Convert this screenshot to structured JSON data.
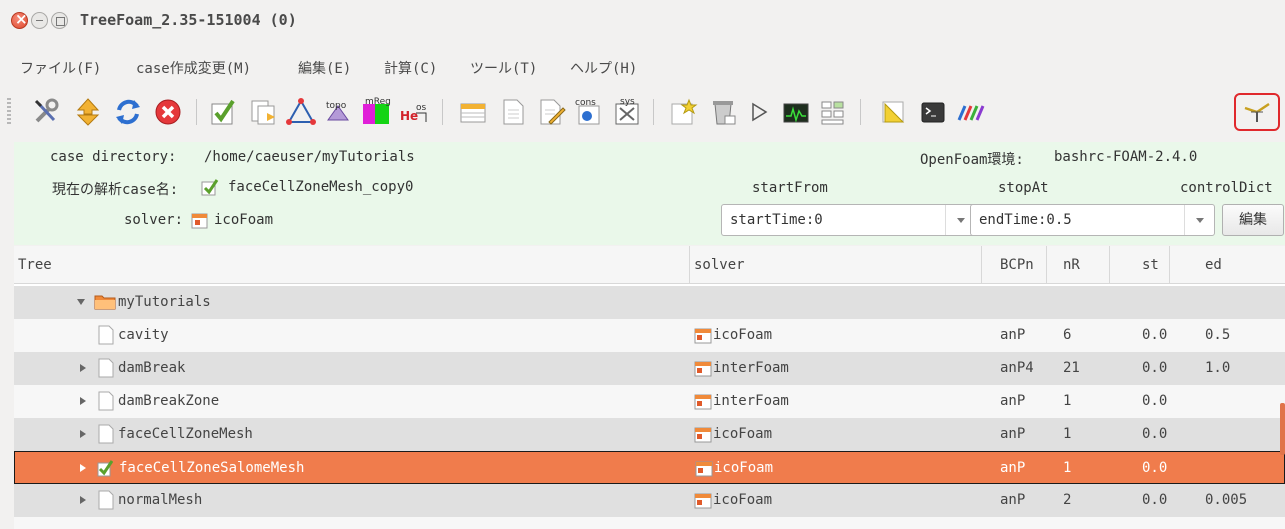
{
  "window": {
    "title": "TreeFoam_2.35-151004 (0)"
  },
  "menu": [
    "ファイル(F)",
    "case作成変更(M)",
    "編集(E)",
    "計算(C)",
    "ツール(T)",
    "ヘルプ(H)"
  ],
  "toolbar": {
    "icons": [
      "tools-icon",
      "updown-icon",
      "refresh-icon",
      "stop-icon",
      "checkmark-case-icon",
      "copy-case-icon",
      "mesh-triangle-icon",
      "topoSet-icon",
      "mReg-icon",
      "helyx-os-icon",
      "table-icon",
      "document-icon",
      "edit-document-icon",
      "constant-icon",
      "system-icon",
      "new-case-icon",
      "clear-icon",
      "run-icon",
      "monitor-icon",
      "layout-icon",
      "ruler-icon",
      "terminal-icon",
      "paraview-icon",
      "plot-icon"
    ],
    "overlay_text": {
      "topo": "topo",
      "mreg": "mReg",
      "helyx_h": "He",
      "helyx_os": "os",
      "cons": "cons",
      "sys": "sys"
    }
  },
  "info": {
    "case_dir_label": "case directory:",
    "case_dir_value": "/home/caeuser/myTutorials",
    "openfoam_label": "OpenFoam環境:",
    "openfoam_value": "bashrc-FOAM-2.4.0",
    "current_case_label": "現在の解析case名:",
    "current_case_value": "faceCellZoneMesh_copy0",
    "solver_label": "solver:",
    "solver_value": "icoFoam",
    "start_from_label": "startFrom",
    "stop_at_label": "stopAt",
    "control_dict_label": "controlDict",
    "start_from_value": "startTime:0",
    "stop_at_value": "endTime:0.5",
    "edit_button": "編集"
  },
  "table": {
    "headers": [
      "Tree",
      "solver",
      "BCPn",
      "nR",
      "st",
      "ed"
    ],
    "root": "myTutorials",
    "rows": [
      {
        "name": "cavity",
        "solver": "icoFoam",
        "bcpn": "anP",
        "nr": "6",
        "st": "0.0",
        "ed": "0.5"
      },
      {
        "name": "damBreak",
        "solver": "interFoam",
        "bcpn": "anP4",
        "nr": "21",
        "st": "0.0",
        "ed": "1.0"
      },
      {
        "name": "damBreakZone",
        "solver": "interFoam",
        "bcpn": "anP",
        "nr": "1",
        "st": "0.0",
        "ed": ""
      },
      {
        "name": "faceCellZoneMesh",
        "solver": "icoFoam",
        "bcpn": "anP",
        "nr": "1",
        "st": "0.0",
        "ed": ""
      },
      {
        "name": "faceCellZoneSalomeMesh",
        "solver": "icoFoam",
        "bcpn": "anP",
        "nr": "1",
        "st": "0.0",
        "ed": ""
      },
      {
        "name": "normalMesh",
        "solver": "icoFoam",
        "bcpn": "anP",
        "nr": "2",
        "st": "0.0",
        "ed": "0.005"
      }
    ]
  },
  "colors": {
    "selection": "#f07c4c",
    "info_bg": "#eaf8ea",
    "highlight_border": "#e0282c"
  }
}
